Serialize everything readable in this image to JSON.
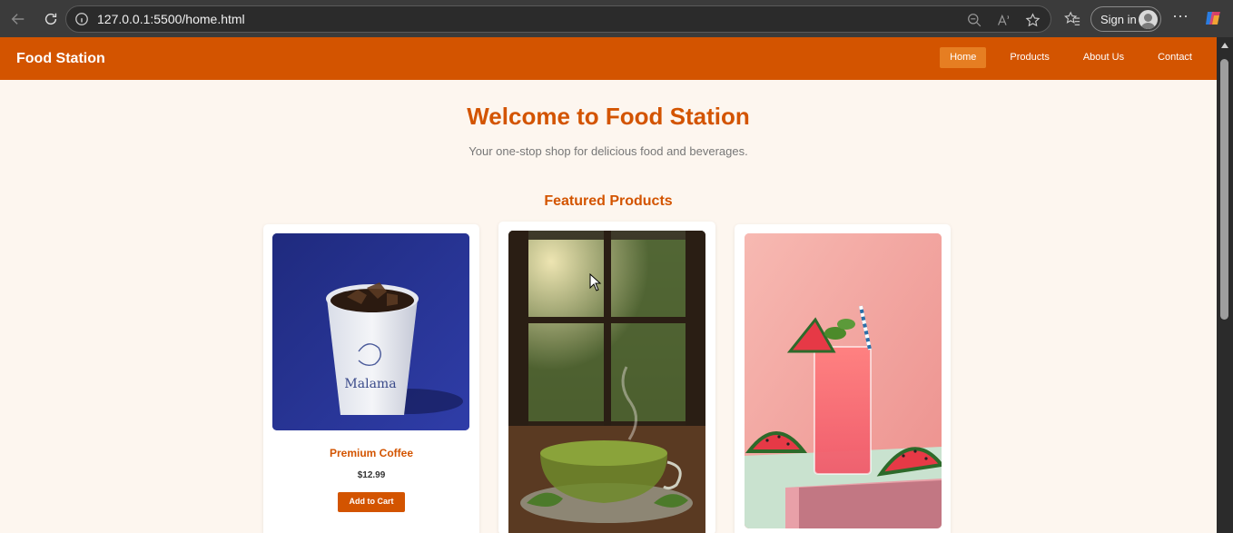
{
  "browser": {
    "url": "127.0.0.1:5500/home.html",
    "sign_in": "Sign in",
    "more": "···"
  },
  "site": {
    "brand": "Food Station",
    "nav": [
      {
        "label": "Home",
        "active": true
      },
      {
        "label": "Products",
        "active": false
      },
      {
        "label": "About Us",
        "active": false
      },
      {
        "label": "Contact",
        "active": false
      }
    ]
  },
  "hero": {
    "title": "Welcome to Food Station",
    "tagline": "Your one-stop shop for delicious food and beverages."
  },
  "featured": {
    "heading": "Featured Products",
    "products": [
      {
        "name": "Premium Coffee",
        "price": "$12.99",
        "button": "Add to Cart",
        "cup_text": "Malama"
      },
      {
        "name": "",
        "price": "",
        "button": ""
      },
      {
        "name": "",
        "price": "",
        "button": ""
      }
    ]
  },
  "colors": {
    "accent": "#d35400",
    "accent_light": "#e67e22",
    "page_bg": "#fdf6ef"
  }
}
